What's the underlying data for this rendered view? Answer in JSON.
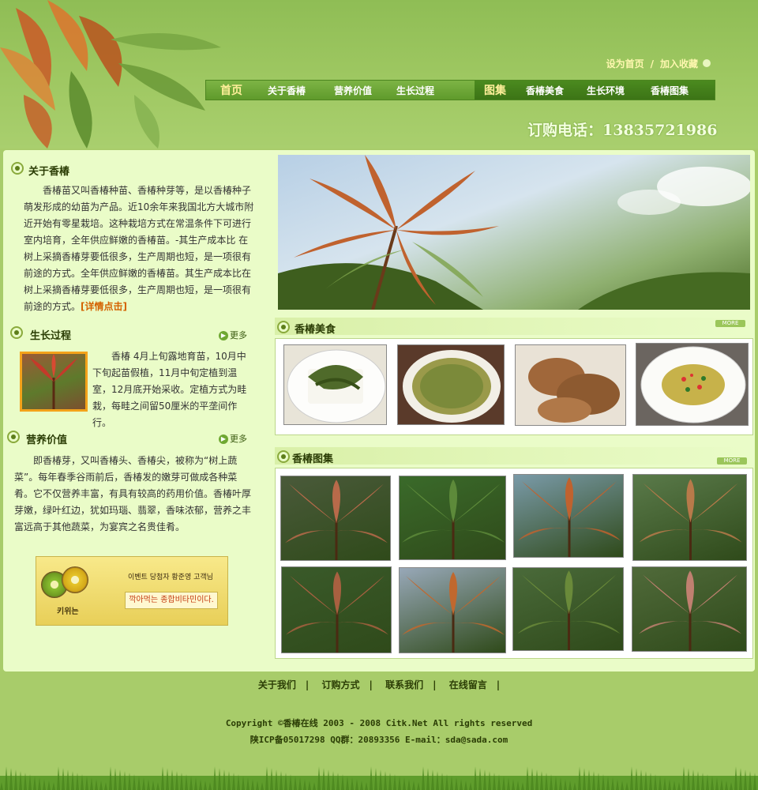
{
  "header": {
    "set_home": "设为首页",
    "sep": "/",
    "add_fav": "加入收藏",
    "phone": "订购电话：13835721986"
  },
  "nav": {
    "home": "首页",
    "about": "关于香椿",
    "nutrition": "营养价值",
    "growth": "生长过程",
    "gallery_big": "图集",
    "food": "香椿美食",
    "env": "生长环境",
    "album": "香椿图集"
  },
  "about": {
    "title": "关于香椿",
    "text": "香椿苗又叫香椿种苗、香椿种芽等，是以香椿种子萌发形成的幼苗为产品。近10余年来我国北方大城市附近开始有零星栽培。这种栽培方式在常温条件下可进行室内培育，全年供应鲜嫩的香椿苗。-其生产成本比 在树上采摘香椿芽要低很多，生产周期也短，是一项很有前途的方式。全年供应鲜嫩的香椿苗。其生产成本比在树上采摘香椿芽要低很多，生产周期也短，是一项很有前途的方式。",
    "detail": "[详情点击]"
  },
  "growth": {
    "title": "生长过程",
    "more": "更多",
    "text": "香椿 4月上旬露地育苗，10月中下旬起苗假植，11月中旬定植到温室，12月底开始采收。定植方式为畦栽，每畦之间留50厘米的平垄间作行。"
  },
  "nutrition": {
    "title": "营养价值",
    "more": "更多",
    "text": "即香椿芽，又叫香椿头、香椿尖，被称为“树上蔬菜”。每年春季谷雨前后，香椿发的嫩芽可做成各种菜肴。它不仅营养丰富，有具有较高的药用价值。香椿叶厚芽嫩，绿叶红边，犹如玛瑙、翡翠，香味浓郁，营养之丰富远高于其他蔬菜，为宴宾之名贵佳肴。"
  },
  "ad": {
    "top_text": "이벤트 당첨자 황준영 고객님",
    "bottom_text": "깍아먹는 종합비타민이다.",
    "brand": "키위는"
  },
  "food": {
    "title": "香椿美食",
    "more": "MORE"
  },
  "album": {
    "title": "香椿图集",
    "more": "MORE"
  },
  "footer": {
    "links": [
      "关于我们",
      "订购方式",
      "联系我们",
      "在线留言"
    ],
    "sep": "|",
    "copyright": "Copyright ©香椿在线 2003 - 2008 Citk.Net All rights reserved",
    "icp": "陕ICP备05017298 QQ群：20893356 E-mail：sda@sada.com"
  },
  "colors": {
    "page_bg": "#a8cc6a",
    "panel_bg": "#eafcc8",
    "nav_dark": "#3c7416",
    "accent_text": "#2b3d05",
    "detail_link": "#d46200"
  }
}
